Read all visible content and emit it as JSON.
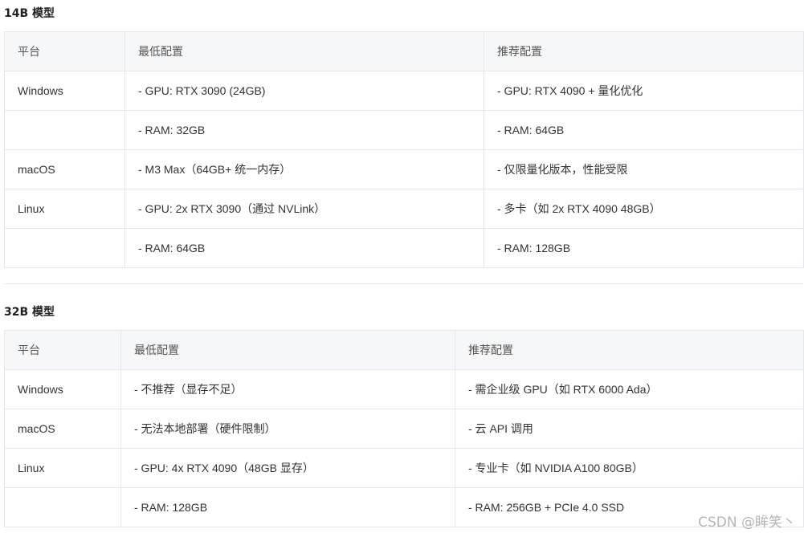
{
  "section_14b": {
    "title": "14B 模型",
    "headers": [
      "平台",
      "最低配置",
      "推荐配置"
    ],
    "rows": [
      [
        "Windows",
        "- GPU: RTX 3090 (24GB)",
        "- GPU: RTX 4090 + 量化优化"
      ],
      [
        "",
        "- RAM: 32GB",
        "- RAM: 64GB"
      ],
      [
        "macOS",
        "- M3 Max（64GB+ 统一内存）",
        "- 仅限量化版本，性能受限"
      ],
      [
        "Linux",
        "- GPU: 2x RTX 3090（通过 NVLink）",
        "- 多卡（如 2x RTX 4090 48GB）"
      ],
      [
        "",
        "- RAM: 64GB",
        "- RAM: 128GB"
      ]
    ]
  },
  "section_32b": {
    "title": "32B 模型",
    "headers": [
      "平台",
      "最低配置",
      "推荐配置"
    ],
    "rows": [
      [
        "Windows",
        "- 不推荐（显存不足）",
        "- 需企业级 GPU（如 RTX 6000 Ada）"
      ],
      [
        "macOS",
        "- 无法本地部署（硬件限制）",
        "- 云 API 调用"
      ],
      [
        "Linux",
        "- GPU: 4x RTX 4090（48GB 显存）",
        "- 专业卡（如 NVIDIA A100 80GB）"
      ],
      [
        "",
        "- RAM: 128GB",
        "- RAM: 256GB + PCIe 4.0 SSD"
      ]
    ]
  },
  "watermark": "CSDN @眸笑丶"
}
